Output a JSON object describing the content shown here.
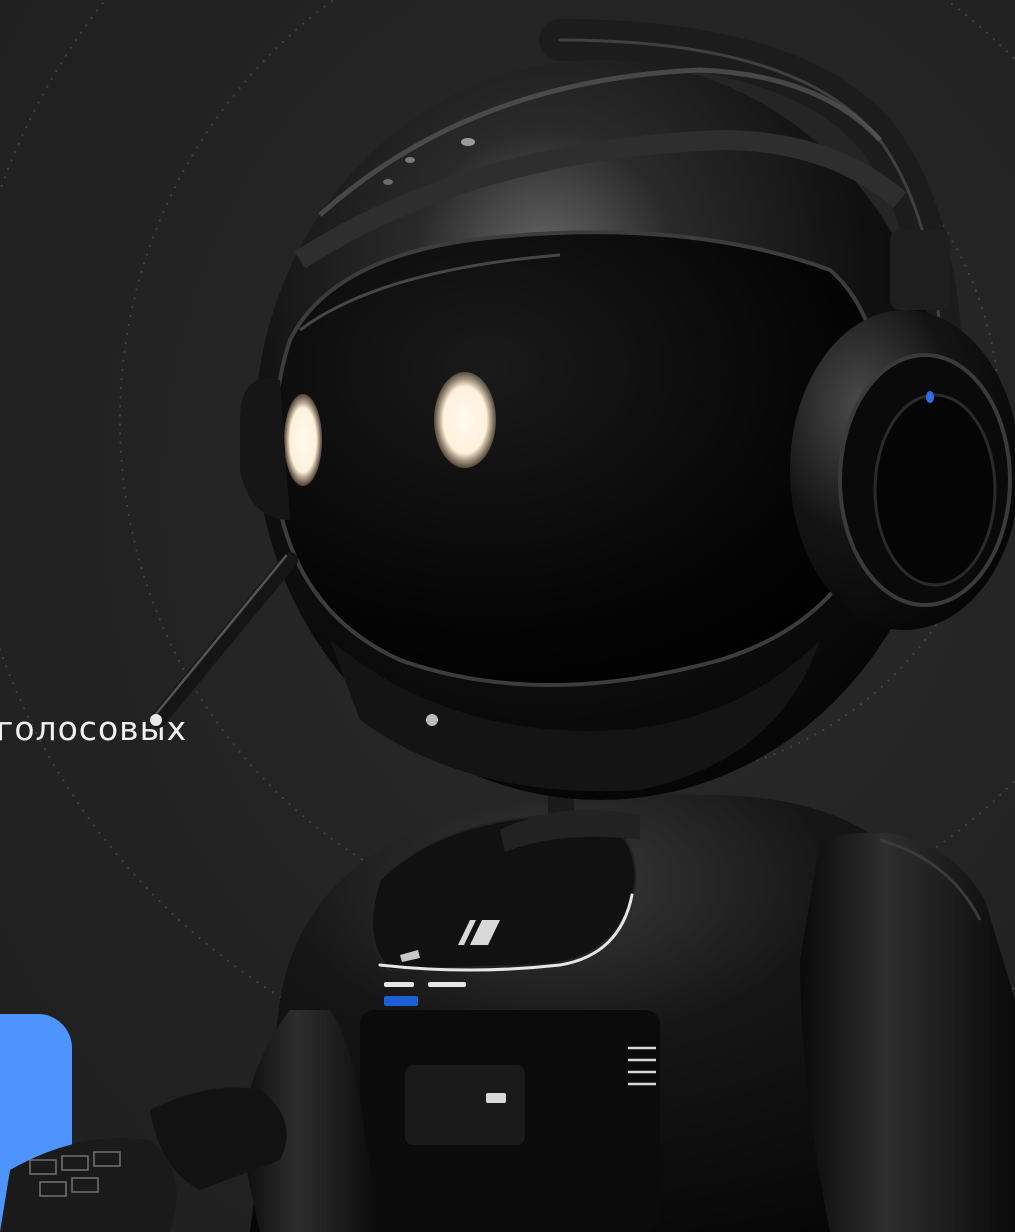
{
  "hero": {
    "text": "голосовых"
  },
  "colors": {
    "background": "#232323",
    "accent": "#4d94ff",
    "eye": "#fff6e8",
    "robot_body": "#0d0d0d"
  },
  "decor": {
    "illustration": "robot-with-headset",
    "rings": "dotted-concentric-circles"
  }
}
